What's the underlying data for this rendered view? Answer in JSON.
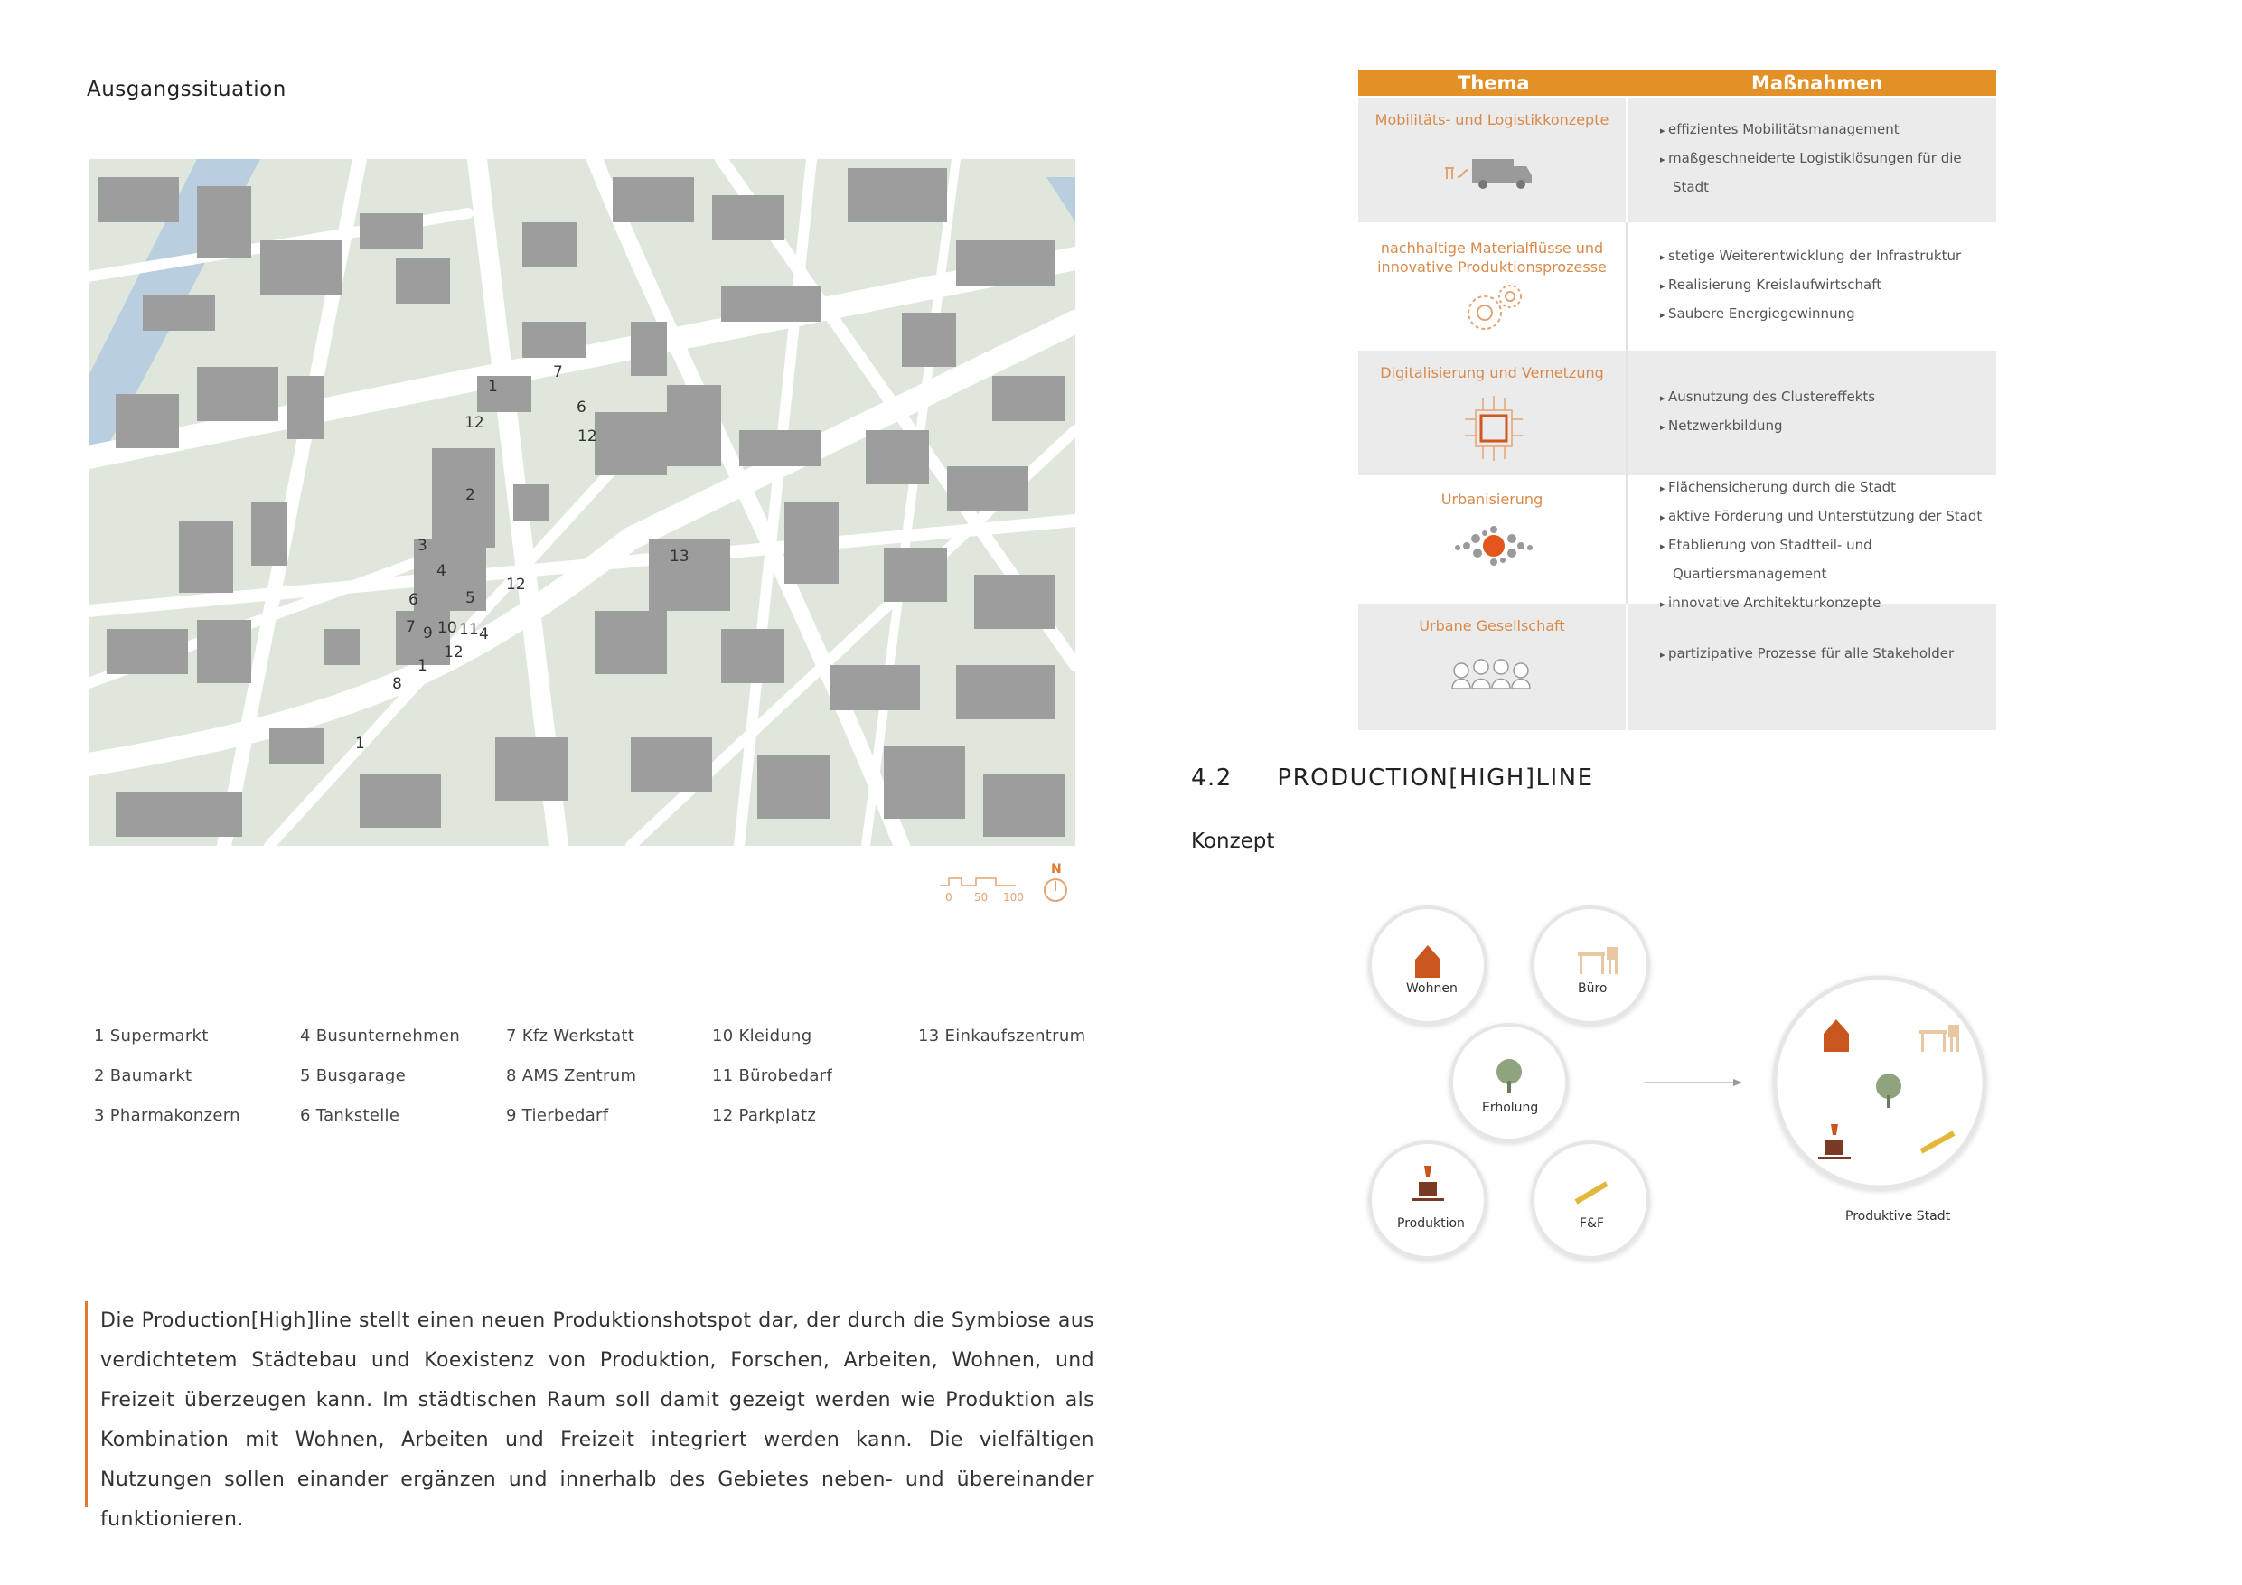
{
  "left": {
    "title": "Ausgangssituation",
    "map_labels": [
      "1",
      "12",
      "2",
      "3",
      "4",
      "5",
      "6",
      "7",
      "9",
      "10",
      "11",
      "4",
      "12",
      "1",
      "8",
      "1",
      "7",
      "6",
      "12",
      "12",
      "13"
    ],
    "scale_labels": [
      "0",
      "50",
      "100"
    ],
    "north_label": "N",
    "legend": [
      [
        "1 Supermarkt",
        "4 Busunternehmen",
        "7 Kfz Werkstatt",
        "10 Kleidung",
        "13 Einkaufszentrum"
      ],
      [
        "2 Baumarkt",
        "5 Busgarage",
        "8 AMS Zentrum",
        "11 Bürobedarf",
        ""
      ],
      [
        "3 Pharmakonzern",
        "6 Tankstelle",
        "9 Tierbedarf",
        "12 Parkplatz",
        ""
      ]
    ],
    "paragraph": "Die Production[High]line stellt einen neuen Produktionshotspot dar, der durch die Symbiose aus verdichtetem Städtebau und Koexistenz von Produktion, Forschen, Arbeiten, Wohnen, und Freizeit überzeugen kann. Im städtischen Raum soll damit gezeigt werden wie Produktion als Kombination mit Wohnen, Arbeiten und Freizeit integriert werden kann. Die vielfältigen Nutzungen sollen einander ergänzen und innerhalb des Gebietes neben- und übereinander funktionieren."
  },
  "table": {
    "header": [
      "Thema",
      "Maßnahmen"
    ],
    "rows": [
      {
        "thema": "Mobilitäts- und Logistikkonzepte",
        "icon": "truck-icon",
        "massnahmen": [
          "effizientes Mobilitätsmanagement",
          "maßgeschneiderte Logistiklösungen für die",
          "Stadt"
        ]
      },
      {
        "thema": "nachhaltige Materialflüsse und innovative Produktionsprozesse",
        "icon": "gears-icon",
        "massnahmen": [
          "stetige Weiterentwicklung der Infrastruktur",
          "Realisierung Kreislaufwirtschaft",
          "Saubere Energiegewinnung"
        ]
      },
      {
        "thema": "Digitalisierung und Vernetzung",
        "icon": "chip-icon",
        "massnahmen": [
          "Ausnutzung des Clustereffekts",
          "Netzwerkbildung"
        ]
      },
      {
        "thema": "Urbanisierung",
        "icon": "cluster-icon",
        "massnahmen": [
          "Flächensicherung durch die Stadt",
          "aktive Förderung und Unterstützung der Stadt",
          "Etablierung von Stadtteil- und",
          "Quartiersmanagement",
          "innovative Architekturkonzepte"
        ]
      },
      {
        "thema": "Urbane Gesellschaft",
        "icon": "people-icon",
        "massnahmen": [
          "partizipative Prozesse für alle Stakeholder"
        ]
      }
    ]
  },
  "section": {
    "number": "4.2",
    "title": "PRODUCTION[HIGH]LINE",
    "subtitle": "Konzept"
  },
  "concept": {
    "circles": [
      "Wohnen",
      "Büro",
      "Erholung",
      "Produktion",
      "F&F"
    ],
    "result": "Produktive Stadt"
  },
  "colors": {
    "accent": "#e39127",
    "orange": "#d0561c",
    "building": "#9d9d9d",
    "green": "#dfe6dc",
    "street": "#ffffff"
  }
}
